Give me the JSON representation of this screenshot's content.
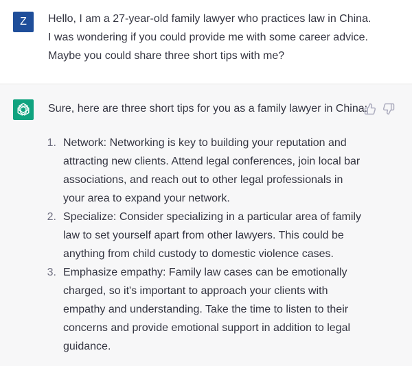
{
  "user_message": {
    "avatar_letter": "Z",
    "lines": [
      "Hello, I am a 27-year-old family lawyer who practices law in China.",
      "I was wondering if you could provide me with some career advice.",
      "Maybe you could share three short tips with me?"
    ]
  },
  "assistant_message": {
    "intro": "Sure, here are three short tips for you as a family lawyer in China:",
    "tips": [
      {
        "number": "1.",
        "lines": [
          "Network: Networking is key to building your reputation and",
          "attracting new clients. Attend legal conferences, join local bar",
          "associations, and reach out to other legal professionals in",
          "your area to expand your network."
        ]
      },
      {
        "number": "2.",
        "lines": [
          "Specialize: Consider specializing in a particular area of family",
          "law to set yourself apart from other lawyers. This could be",
          "anything from child custody to domestic violence cases."
        ]
      },
      {
        "number": "3.",
        "lines": [
          "Emphasize empathy: Family law cases can be emotionally",
          "charged, so it's important to approach your clients with",
          "empathy and understanding. Take the time to listen to their",
          "concerns and provide emotional support in addition to legal",
          "guidance."
        ]
      }
    ]
  },
  "icons": {
    "user_avatar_color": "#1f4e9a",
    "assistant_avatar_color": "#10a37f",
    "assistant_avatar": "openai-logo-icon",
    "thumbs_up": "thumbs-up-icon",
    "thumbs_down": "thumbs-down-icon"
  }
}
